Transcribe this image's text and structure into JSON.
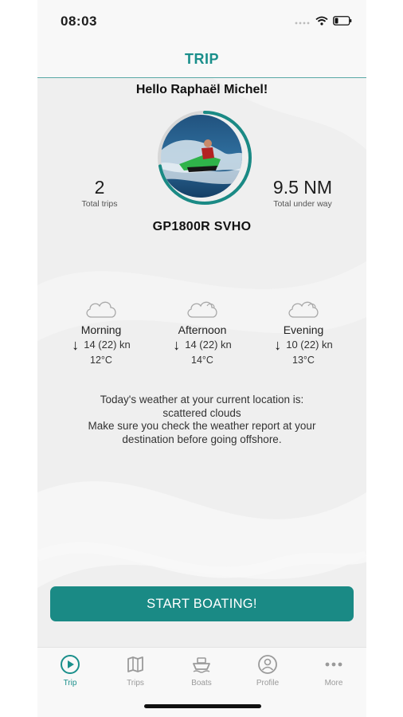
{
  "status_bar": {
    "time": "08:03",
    "icons": [
      "signal-icon",
      "wifi-icon",
      "battery-icon"
    ]
  },
  "header": {
    "title": "TRIP"
  },
  "greeting": "Hello Raphaël Michel!",
  "stats": {
    "trips": {
      "value": "2",
      "label": "Total trips"
    },
    "distance": {
      "value": "9.5 NM",
      "label": "Total under way"
    }
  },
  "boat": {
    "name": "GP1800R SVHO",
    "progress_fraction": 0.72
  },
  "weather": [
    {
      "period": "Morning",
      "wind": "14 (22) kn",
      "temp": "12°C",
      "icon": "cloud-icon"
    },
    {
      "period": "Afternoon",
      "wind": "14 (22) kn",
      "temp": "14°C",
      "icon": "cloud-icon"
    },
    {
      "period": "Evening",
      "wind": "10 (22) kn",
      "temp": "13°C",
      "icon": "cloud-icon"
    }
  ],
  "weather_text": {
    "line1": "Today's weather at your current location is:",
    "line2": "scattered clouds",
    "line3": "Make sure you check the weather report at your",
    "line4": "destination before going offshore."
  },
  "start_button": "START BOATING!",
  "tabs": [
    {
      "label": "Trip",
      "icon": "play-icon",
      "active": true
    },
    {
      "label": "Trips",
      "icon": "map-icon",
      "active": false
    },
    {
      "label": "Boats",
      "icon": "boat-icon",
      "active": false
    },
    {
      "label": "Profile",
      "icon": "profile-icon",
      "active": false
    },
    {
      "label": "More",
      "icon": "more-icon",
      "active": false
    }
  ],
  "colors": {
    "accent": "#1a8a85",
    "tab_inactive": "#9a9a9a",
    "background": "#efefef"
  }
}
